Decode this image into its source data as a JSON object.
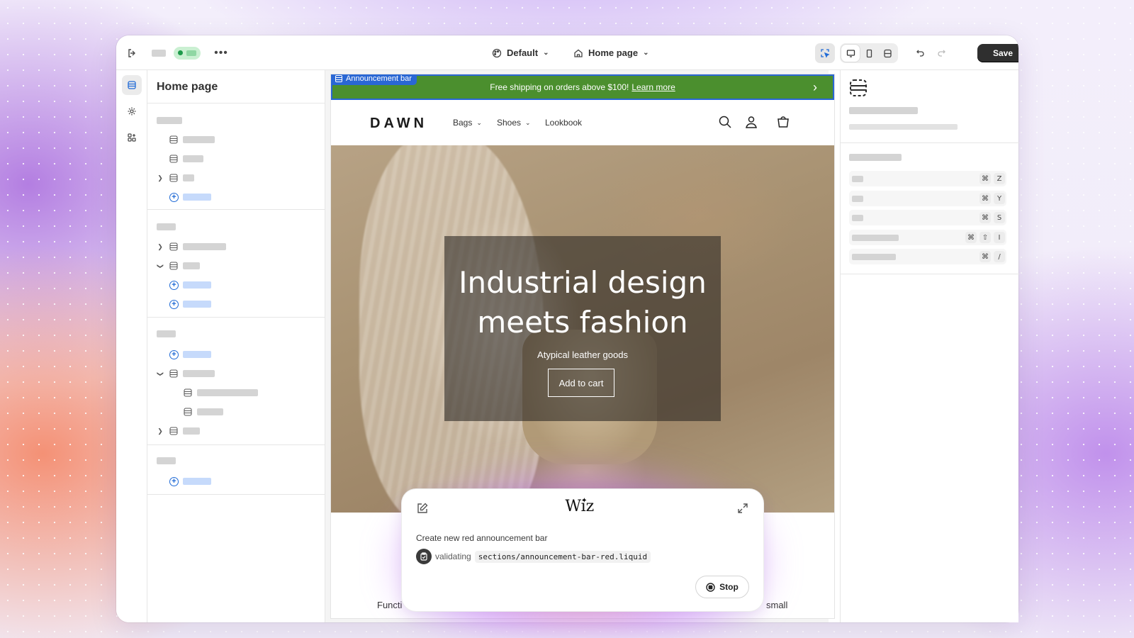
{
  "topbar": {
    "theme_dropdown": "Default",
    "page_dropdown": "Home page",
    "save_label": "Save"
  },
  "sections_panel": {
    "title": "Home page"
  },
  "preview": {
    "announcement_tag": "Announcement bar",
    "announcement_text": "Free shipping on orders above $100!",
    "announcement_link": "Learn more",
    "logo": "DAWN",
    "nav": [
      "Bags",
      "Shoes",
      "Lookbook"
    ],
    "hero_title_line1": "Industrial design",
    "hero_title_line2": "meets fashion",
    "hero_subtitle": "Atypical leather goods",
    "hero_button": "Add to cart",
    "below_text_left": "Functi",
    "below_text_right": "small"
  },
  "shortcuts": [
    {
      "keys": [
        "⌘",
        "Z"
      ]
    },
    {
      "keys": [
        "⌘",
        "Y"
      ]
    },
    {
      "keys": [
        "⌘",
        "S"
      ]
    },
    {
      "keys": [
        "⌘",
        "⇧",
        "I"
      ]
    },
    {
      "keys": [
        "⌘",
        "/"
      ]
    }
  ],
  "wiz": {
    "logo": "Wiz",
    "prompt": "Create new red announcement bar",
    "status_word": "validating",
    "status_file": "sections/announcement-bar-red.liquid",
    "stop_label": "Stop"
  },
  "colors": {
    "announcement_bg": "#4b8f2e",
    "selection_blue": "#2a67d4",
    "save_bg": "#2f2f2f",
    "status_green": "#1d9a4a"
  }
}
